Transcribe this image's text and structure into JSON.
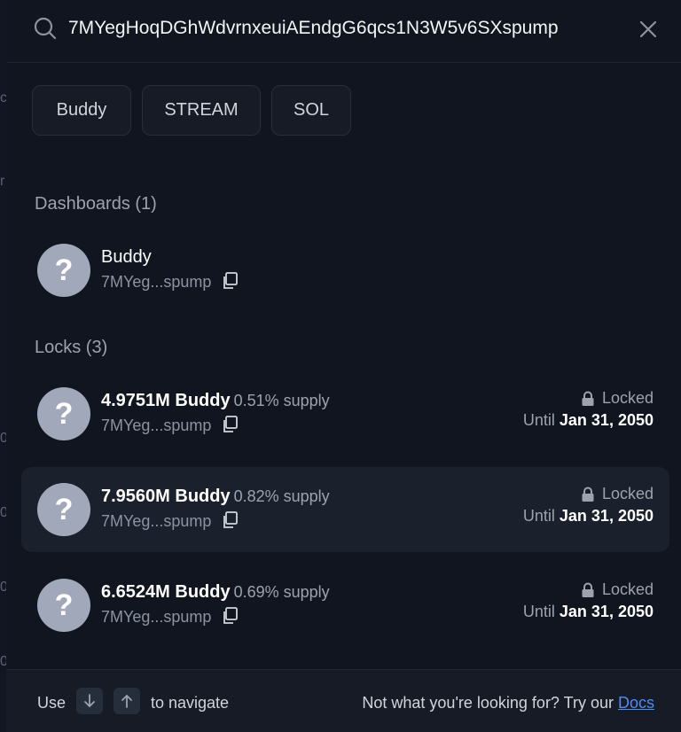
{
  "background": {
    "fragments": [
      "c",
      "r",
      "0",
      "0",
      "0",
      "0"
    ]
  },
  "search": {
    "value": "7MYegHoqDGhWdvrnxeuiAEndgG6qcs1N3W5v6SXspump",
    "placeholder": ""
  },
  "chips": [
    "Buddy",
    "STREAM",
    "SOL"
  ],
  "dashboards": {
    "title": "Dashboards (1)",
    "items": [
      {
        "avatar": "?",
        "name": "Buddy",
        "address": "7MYeg...spump"
      }
    ]
  },
  "locks": {
    "title": "Locks (3)",
    "items": [
      {
        "avatar": "?",
        "amount": "4.9751M Buddy",
        "supply": "0.51% supply",
        "address": "7MYeg...spump",
        "status": "Locked",
        "until_label": "Until",
        "until_date": "Jan 31, 2050"
      },
      {
        "avatar": "?",
        "amount": "7.9560M Buddy",
        "supply": "0.82% supply",
        "address": "7MYeg...spump",
        "status": "Locked",
        "until_label": "Until",
        "until_date": "Jan 31, 2050"
      },
      {
        "avatar": "?",
        "amount": "6.6524M Buddy",
        "supply": "0.69% supply",
        "address": "7MYeg...spump",
        "status": "Locked",
        "until_label": "Until",
        "until_date": "Jan 31, 2050"
      }
    ]
  },
  "footer": {
    "use_label": "Use",
    "navigate_label": "to navigate",
    "help_text": "Not what you're looking for? Try our",
    "docs_label": "Docs"
  },
  "colors": {
    "accent_link": "#4f8cf7",
    "modal_bg": "#111520",
    "avatar_bg": "#a0a8ba"
  },
  "icons": [
    "search-icon",
    "close-icon",
    "copy-icon",
    "lock-icon",
    "arrow-down-icon",
    "arrow-up-icon"
  ]
}
